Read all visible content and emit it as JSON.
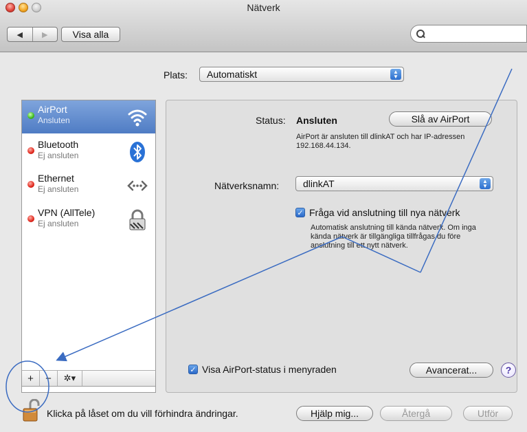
{
  "window": {
    "title": "Nätverk"
  },
  "toolbar": {
    "back_label": "◀",
    "forward_label": "▶",
    "show_all_label": "Visa alla",
    "search": {
      "value": "",
      "placeholder": ""
    }
  },
  "location": {
    "label": "Plats:",
    "value": "Automatiskt"
  },
  "services": [
    {
      "name": "AirPort",
      "status": "Ansluten",
      "connected": true,
      "icon": "wifi-icon"
    },
    {
      "name": "Bluetooth",
      "status": "Ej ansluten",
      "connected": false,
      "icon": "bluetooth-icon"
    },
    {
      "name": "Ethernet",
      "status": "Ej ansluten",
      "connected": false,
      "icon": "ethernet-icon"
    },
    {
      "name": "VPN (AllTele)",
      "status": "Ej ansluten",
      "connected": false,
      "icon": "lock-icon"
    }
  ],
  "list_buttons": {
    "add": "+",
    "remove": "−",
    "action": "✲▾"
  },
  "detail": {
    "status_label": "Status:",
    "status_value": "Ansluten",
    "toggle_button": "Slå av AirPort",
    "status_desc": "AirPort är ansluten till dlinkAT och har IP-adressen 192.168.44.134.",
    "network_label": "Nätverksnamn:",
    "network_value": "dlinkAT",
    "ask_checkbox_label": "Fråga vid anslutning till nya nätverk",
    "ask_checked": true,
    "ask_desc": "Automatisk anslutning till kända nätverk. Om inga kända nätverk är tillgängliga tillfrågas du före anslutning till ett nytt nätverk.",
    "menubar_checkbox_label": "Visa AirPort-status i menyraden",
    "menubar_checked": true,
    "advanced_button": "Avancerat...",
    "help_button": "?"
  },
  "footer": {
    "lock_text": "Klicka på låset om du vill förhindra ändringar.",
    "help_button": "Hjälp mig...",
    "revert_button": "Återgå",
    "apply_button": "Utför"
  },
  "colors": {
    "selection": "#5a84c9",
    "annotation": "#3a6bc1",
    "connected": "#3dba1d",
    "disconnected": "#e0261b"
  }
}
